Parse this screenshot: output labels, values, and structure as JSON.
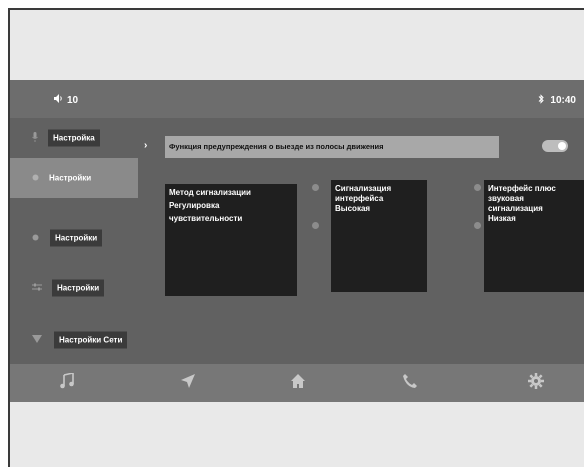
{
  "statusbar": {
    "volume_icon": "volume-icon",
    "volume_value": "10",
    "bluetooth_icon": "bluetooth-icon",
    "time": "10:40"
  },
  "sidebar": {
    "items": [
      {
        "label": "Настройка",
        "icon": "mic-icon"
      },
      {
        "label": "Настройки",
        "icon": "dot-icon",
        "active": true
      },
      {
        "label": "Настройки",
        "icon": "dot-icon"
      },
      {
        "label": "Настройки",
        "icon": "equalizer-icon"
      },
      {
        "label": "Настройки Сети",
        "icon": "wifi-icon"
      }
    ]
  },
  "main": {
    "warning_label": "Функция предупреждения о выезде из полосы движения",
    "toggle_on": true,
    "panels": [
      {
        "lines": [
          "Метод сигнализации",
          "Регулировка",
          "чувствительности"
        ]
      },
      {
        "lines": [
          "Сигнализация",
          "интерфейса",
          "Высокая"
        ]
      },
      {
        "lines": [
          "Интерфейс плюс",
          "звуковая",
          "сигнализация",
          "Низкая"
        ]
      }
    ]
  },
  "bottom_nav": {
    "items": [
      "music-icon",
      "navigation-icon",
      "home-icon",
      "phone-icon",
      "settings-icon"
    ]
  },
  "colors": {
    "screen_bg": "#616161",
    "active_item": "#8a8a8a",
    "panel_bg": "#1f1f1f"
  }
}
